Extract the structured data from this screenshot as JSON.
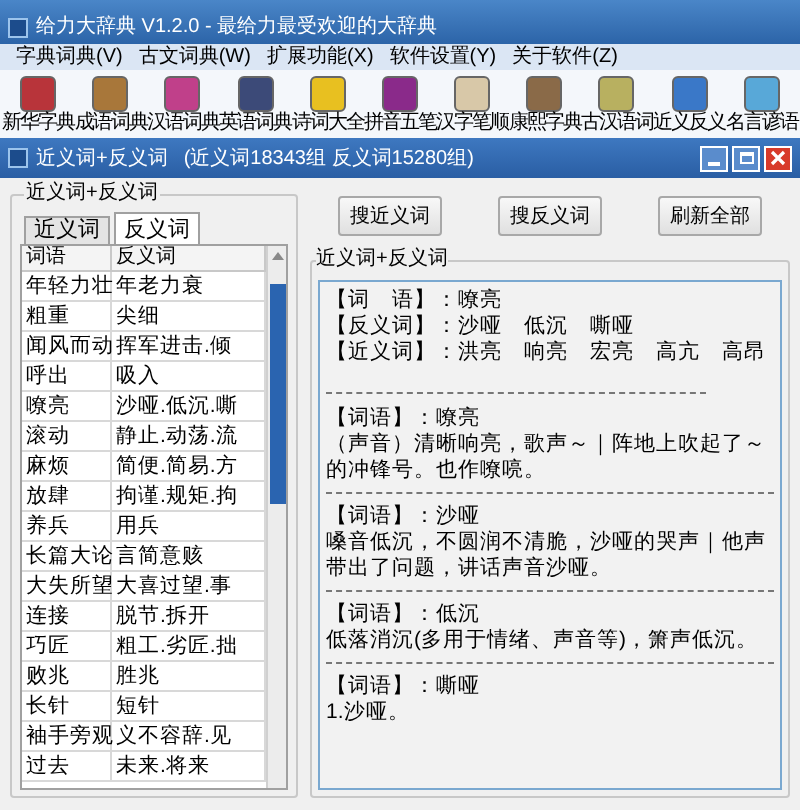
{
  "window": {
    "title": "给力大辞典 V1.2.0  -  最给力最受欢迎的大辞典"
  },
  "menu": [
    "字典词典(V)",
    "古文词典(W)",
    "扩展功能(X)",
    "软件设置(Y)",
    "关于软件(Z)"
  ],
  "toolbar": [
    {
      "label": "新华字典",
      "color": "#b8343a"
    },
    {
      "label": "成语词典",
      "color": "#a8773a"
    },
    {
      "label": "汉语词典",
      "color": "#c0408a"
    },
    {
      "label": "英语词典",
      "color": "#3c4a78"
    },
    {
      "label": "诗词大全",
      "color": "#e8c020"
    },
    {
      "label": "拼音五笔",
      "color": "#8a2a8a"
    },
    {
      "label": "汉字笔顺",
      "color": "#d8c8a8"
    },
    {
      "label": "康熙字典",
      "color": "#8a6a48"
    },
    {
      "label": "古汉语词",
      "color": "#b8b060"
    },
    {
      "label": "近义反义",
      "color": "#3a78c8"
    },
    {
      "label": "名言谚语",
      "color": "#58a8d8"
    }
  ],
  "subwindow": {
    "title": "近义词+反义词",
    "subtitle": "(近义词18343组 反义词15280组)"
  },
  "left_group": {
    "legend": "近义词+反义词",
    "tabs": [
      {
        "label": "近义词",
        "selected": false
      },
      {
        "label": "反义词",
        "selected": true
      }
    ],
    "table": {
      "columns": [
        "词语",
        "反义词"
      ],
      "rows": [
        [
          "年轻力壮",
          "年老力衰"
        ],
        [
          "粗重",
          "尖细"
        ],
        [
          "闻风而动",
          "挥军进击.倾"
        ],
        [
          "呼出",
          "吸入"
        ],
        [
          "嘹亮",
          "沙哑.低沉.嘶"
        ],
        [
          "滚动",
          "静止.动荡.流"
        ],
        [
          "麻烦",
          "简便.简易.方"
        ],
        [
          "放肆",
          "拘谨.规矩.拘"
        ],
        [
          "养兵",
          "用兵"
        ],
        [
          "长篇大论",
          "言简意赅"
        ],
        [
          "大失所望",
          "大喜过望.事"
        ],
        [
          "连接",
          "脱节.拆开"
        ],
        [
          "巧匠",
          "粗工.劣匠.拙"
        ],
        [
          "败兆",
          "胜兆"
        ],
        [
          "长针",
          "短针"
        ],
        [
          "袖手旁观",
          "义不容辞.见"
        ],
        [
          "过去",
          "未来.将来"
        ]
      ]
    }
  },
  "buttons": [
    "搜近义词",
    "搜反义词",
    "刷新全部"
  ],
  "right_group": {
    "legend": "近义词+反义词",
    "summary": [
      "【词　语】：嘹亮",
      "【反义词】：沙哑　低沉　嘶哑",
      "【近义词】：洪亮　响亮　宏亮　高亢　高昂"
    ],
    "entries": [
      {
        "heading": "【词语】：嘹亮",
        "definition": "（声音）清晰响亮，歌声～｜阵地上吹起了～的冲锋号。也作嘹喨。"
      },
      {
        "heading": "【词语】：沙哑",
        "definition": "嗓音低沉，不圆润不清脆，沙哑的哭声｜他声带出了问题，讲话声音沙哑。"
      },
      {
        "heading": "【词语】：低沉",
        "definition": "低落消沉(多用于情绪、声音等)，箫声低沉。"
      },
      {
        "heading": "【词语】：嘶哑",
        "definition": "1.沙哑。"
      }
    ]
  }
}
